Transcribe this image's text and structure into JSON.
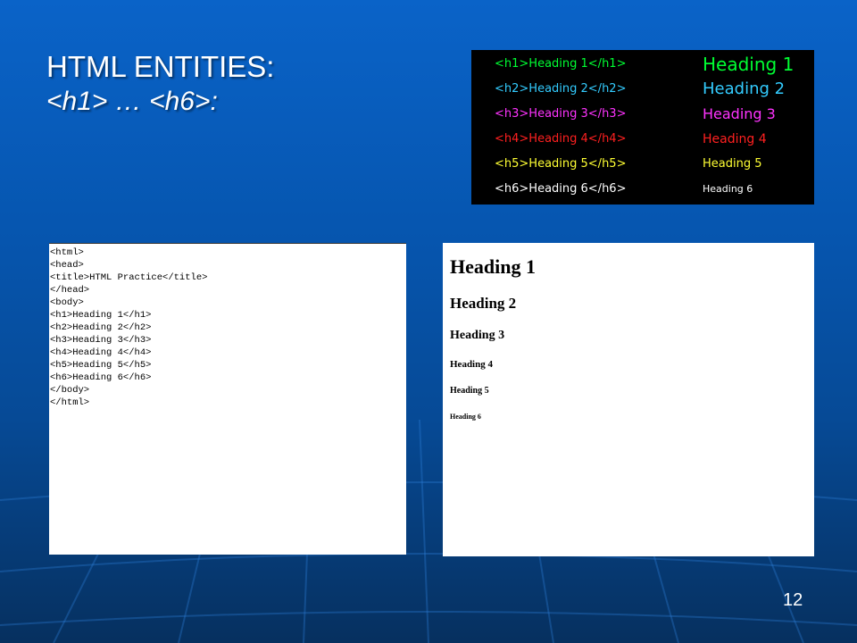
{
  "slide": {
    "title": "HTML ENTITIES:",
    "subtitle": "<h1> … <h6>:",
    "page_number": "12"
  },
  "reference": {
    "rows": [
      {
        "tag": "<h1>Heading 1</h1>",
        "output": "Heading 1",
        "color": "#00ff33"
      },
      {
        "tag": "<h2>Heading 2</h2>",
        "output": "Heading 2",
        "color": "#33ccff"
      },
      {
        "tag": "<h3>Heading 3</h3>",
        "output": "Heading 3",
        "color": "#ff33ff"
      },
      {
        "tag": "<h4>Heading 4</h4>",
        "output": "Heading 4",
        "color": "#ff2020"
      },
      {
        "tag": "<h5>Heading 5</h5>",
        "output": "Heading 5",
        "color": "#ffff33"
      },
      {
        "tag": "<h6>Heading 6</h6>",
        "output": "Heading 6",
        "color": "#ffffff"
      }
    ]
  },
  "source_code": {
    "lines": [
      "<html>",
      "<head>",
      "<title>HTML Practice</title>",
      "</head>",
      "<body>",
      "<h1>Heading 1</h1>",
      "<h2>Heading 2</h2>",
      "<h3>Heading 3</h3>",
      "<h4>Heading 4</h4>",
      "<h5>Heading 5</h5>",
      "<h6>Heading 6</h6>",
      "</body>",
      "</html>"
    ]
  },
  "rendered": {
    "headings": [
      "Heading 1",
      "Heading 2",
      "Heading 3",
      "Heading 4",
      "Heading 5",
      "Heading 6"
    ]
  }
}
